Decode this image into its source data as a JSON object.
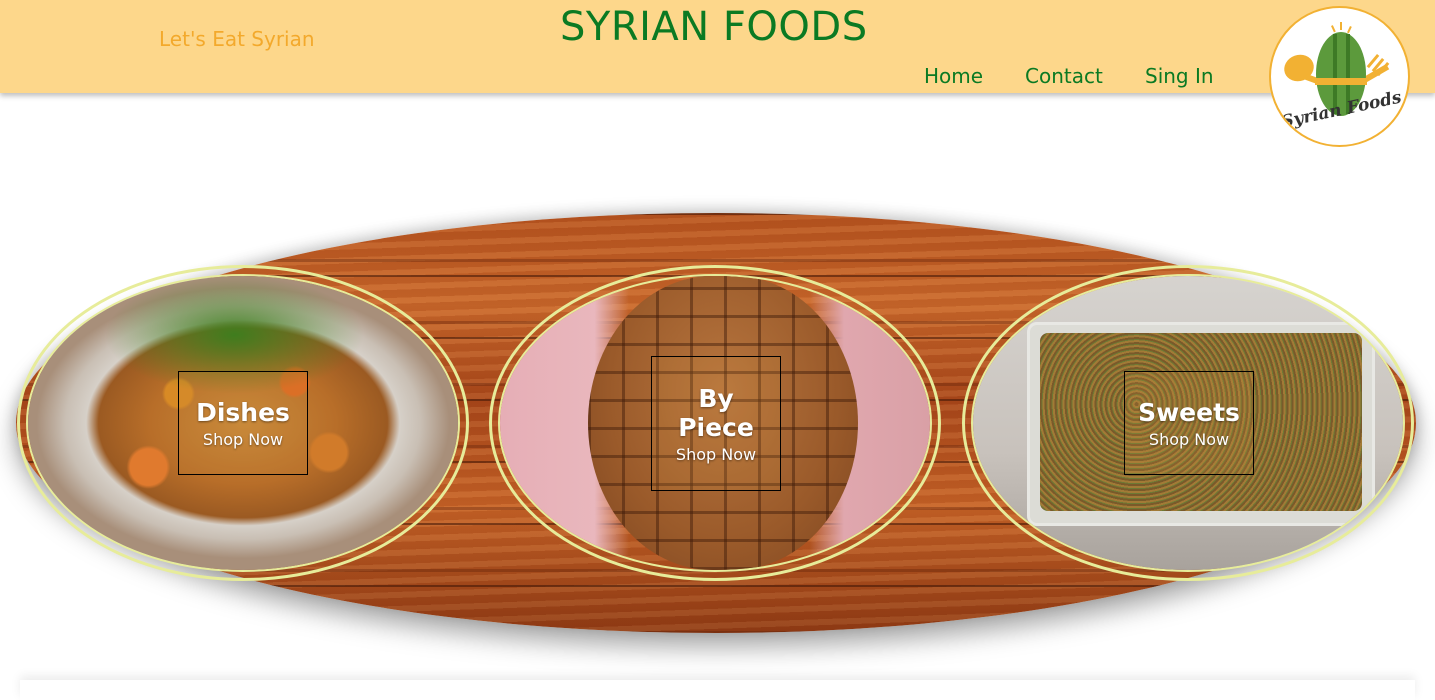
{
  "header": {
    "tagline": "Let's Eat Syrian",
    "title": "SYRIAN FOODS",
    "nav": [
      {
        "label": "Home"
      },
      {
        "label": "Contact"
      },
      {
        "label": "Sing In"
      }
    ],
    "logo_text": "Syrian Foods"
  },
  "categories": [
    {
      "name": "Dishes",
      "cta": "Shop Now"
    },
    {
      "name": "By Piece",
      "cta": "Shop Now"
    },
    {
      "name": "Sweets",
      "cta": "Shop Now"
    }
  ],
  "colors": {
    "header_bg": "#fdd78b",
    "brand_green": "#0b7a23",
    "tagline_orange": "#f3a92c",
    "oval_border": "#e7ec9a"
  }
}
